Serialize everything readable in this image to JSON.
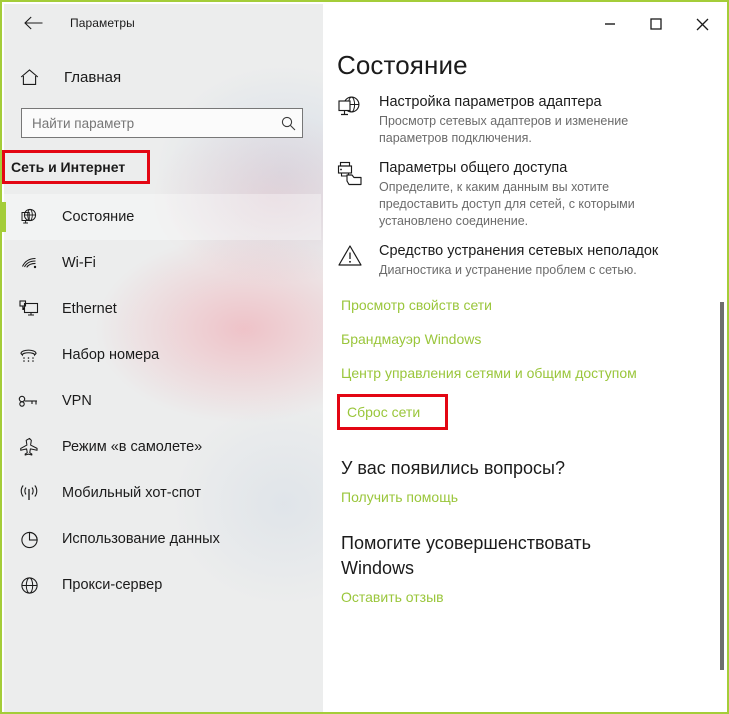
{
  "window": {
    "title": "Параметры",
    "accent_color": "#a4cd39",
    "highlight_color": "#e30613",
    "link_color": "#9ac63b",
    "back_icon": "back-arrow-icon",
    "controls": {
      "minimize": "minimize-icon",
      "maximize": "maximize-icon",
      "close": "close-icon"
    }
  },
  "sidebar": {
    "home": {
      "label": "Главная",
      "icon": "home-icon"
    },
    "search": {
      "placeholder": "Найти параметр",
      "value": "",
      "icon": "search-icon"
    },
    "category": {
      "label": "Сеть и Интернет",
      "highlighted": true
    },
    "items": [
      {
        "label": "Состояние",
        "icon": "globe-monitor-icon",
        "selected": true
      },
      {
        "label": "Wi-Fi",
        "icon": "wifi-icon",
        "selected": false
      },
      {
        "label": "Ethernet",
        "icon": "ethernet-icon",
        "selected": false
      },
      {
        "label": "Набор номера",
        "icon": "dialup-phone-icon",
        "selected": false
      },
      {
        "label": "VPN",
        "icon": "vpn-key-icon",
        "selected": false
      },
      {
        "label": "Режим «в самолете»",
        "icon": "airplane-icon",
        "selected": false
      },
      {
        "label": "Мобильный хот-спот",
        "icon": "hotspot-icon",
        "selected": false
      },
      {
        "label": "Использование данных",
        "icon": "pie-chart-icon",
        "selected": false
      },
      {
        "label": "Прокси-сервер",
        "icon": "globe-icon",
        "selected": false
      }
    ]
  },
  "main": {
    "page_title": "Состояние",
    "entries": [
      {
        "title": "Настройка параметров адаптера",
        "desc": "Просмотр сетевых адаптеров и изменение параметров подключения.",
        "icon": "globe-monitor-icon"
      },
      {
        "title": "Параметры общего доступа",
        "desc": "Определите, к каким данным вы хотите предоставить доступ для сетей, с которыми установлено соединение.",
        "icon": "sharing-printer-folder-icon"
      },
      {
        "title": "Средство устранения сетевых неполадок",
        "desc": "Диагностика и устранение проблем с сетью.",
        "icon": "warning-triangle-icon"
      }
    ],
    "links": [
      "Просмотр свойств сети",
      "Брандмауэр Windows",
      "Центр управления сетями и общим доступом"
    ],
    "reset_link": {
      "label": "Сброс сети",
      "highlighted": true
    },
    "questions_heading": "У вас появились вопросы?",
    "help_link": "Получить помощь",
    "improve_heading": "Помогите усовершенствовать Windows",
    "feedback_link": "Оставить отзыв"
  },
  "scrollbar": {
    "position": "right",
    "visible": true
  }
}
